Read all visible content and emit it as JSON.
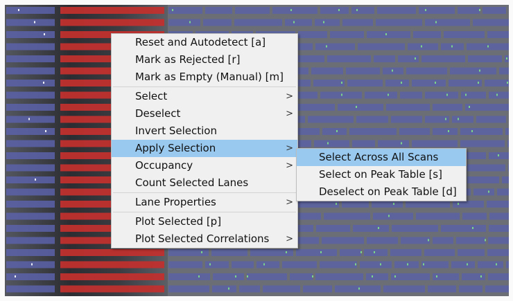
{
  "context_menu": {
    "groups": [
      [
        {
          "label": "Reset and Autodetect [a]",
          "submenu": false
        },
        {
          "label": "Mark as Rejected [r]",
          "submenu": false
        },
        {
          "label": "Mark as Empty (Manual) [m]",
          "submenu": false
        }
      ],
      [
        {
          "label": "Select",
          "submenu": true
        },
        {
          "label": "Deselect",
          "submenu": true
        },
        {
          "label": "Invert Selection",
          "submenu": false
        },
        {
          "label": "Apply Selection",
          "submenu": true,
          "highlighted": true
        },
        {
          "label": "Occupancy",
          "submenu": true
        },
        {
          "label": "Count Selected Lanes",
          "submenu": false
        }
      ],
      [
        {
          "label": "Lane Properties",
          "submenu": true
        }
      ],
      [
        {
          "label": "Plot Selected [p]",
          "submenu": false
        },
        {
          "label": "Plot Selected Correlations",
          "submenu": true
        }
      ]
    ]
  },
  "submenu": {
    "items": [
      {
        "label": "Select Across All Scans",
        "highlighted": true
      },
      {
        "label": "Select on Peak Table [s]"
      },
      {
        "label": "Deselect on Peak Table [d]"
      }
    ]
  },
  "submenu_arrow": ">",
  "colors": {
    "highlight": "#99c9ef",
    "menu_bg": "#f0f0f0",
    "lane_blue": "#5a62a8",
    "lane_red": "#c0302e",
    "spot_green": "#7fe08a"
  }
}
